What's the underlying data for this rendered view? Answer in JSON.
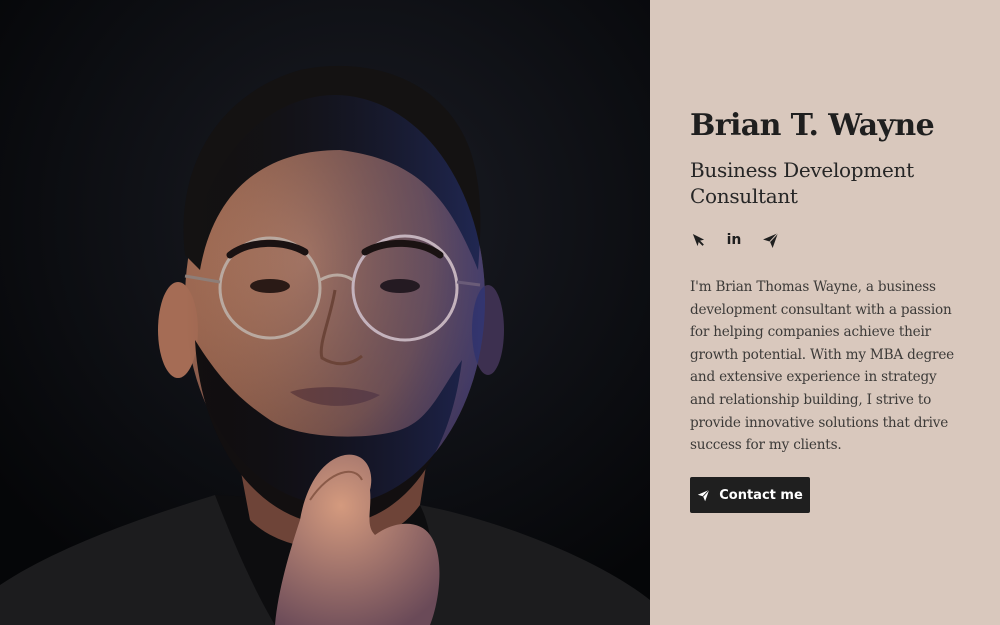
{
  "profile": {
    "name": "Brian T. Wayne",
    "role": "Business Development Consultant",
    "bio": "I'm Brian Thomas Wayne, a business development consultant with a passion for helping companies achieve their growth potential. With my MBA degree and extensive experience in strategy and relationship building, I strive to provide innovative solutions that drive success for my clients."
  },
  "photo": {
    "alt": "Portrait of a bearded man with round glasses resting his chin on his hand"
  },
  "social": [
    {
      "icon": "cursor-icon"
    },
    {
      "icon": "linkedin-icon",
      "label": "in"
    },
    {
      "icon": "telegram-icon"
    }
  ],
  "contact_button": {
    "label": "Contact me",
    "icon": "telegram-icon"
  },
  "colors": {
    "panel_bg": "#d9c8bd",
    "text_dark": "#1f1f1f",
    "text_body": "#3c3a38",
    "photo_bg": "#07080b",
    "button_bg": "#1f1f1f"
  }
}
